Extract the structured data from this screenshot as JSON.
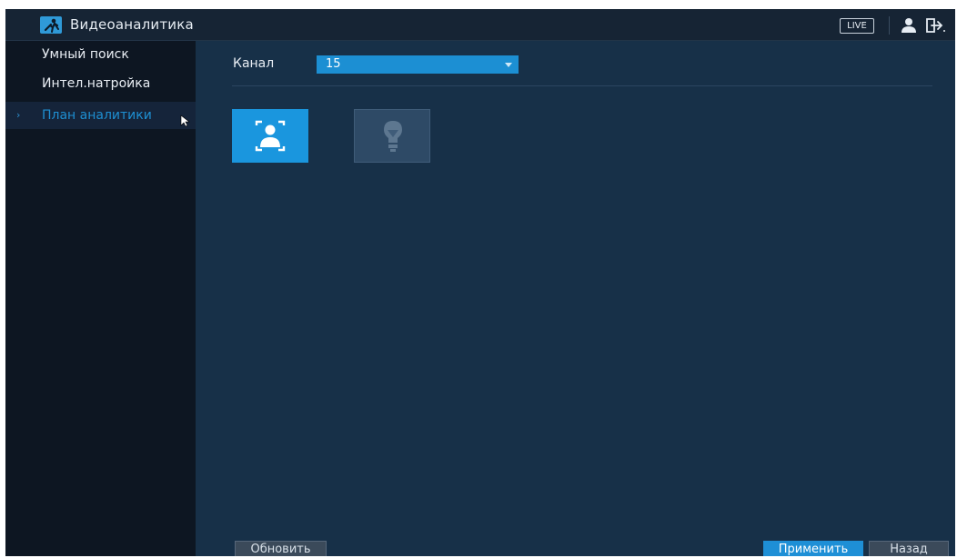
{
  "header": {
    "title": "Видеоаналитика",
    "live_label": "LIVE",
    "icons": [
      "video-analytics-icon",
      "user-icon",
      "logout-icon"
    ]
  },
  "sidebar": {
    "items": [
      {
        "label": "Умный поиск",
        "active": false
      },
      {
        "label": "Интел.натройка",
        "active": false
      },
      {
        "label": "План аналитики",
        "active": true
      }
    ]
  },
  "main": {
    "channel": {
      "label": "Канал",
      "value": "15"
    },
    "tiles": [
      {
        "icon": "face-detection-icon",
        "selected": true
      },
      {
        "icon": "lightbulb-icon",
        "selected": false
      }
    ]
  },
  "footer": {
    "refresh_label": "Обновить",
    "apply_label": "Применить",
    "back_label": "Назад"
  },
  "colors": {
    "accent": "#1e8fd6",
    "main_bg": "#173048",
    "sidebar_bg": "#0d1622"
  }
}
